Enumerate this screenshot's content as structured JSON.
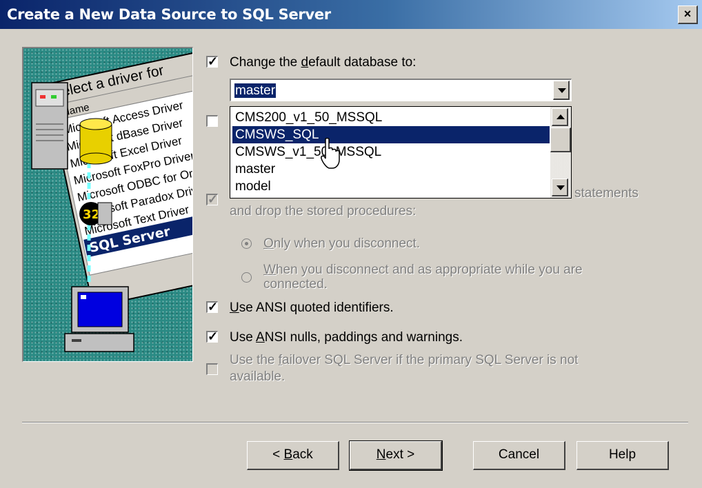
{
  "window": {
    "title": "Create a New Data Source to SQL Server",
    "close_glyph": "×"
  },
  "illustration": {
    "heading": "Select a driver for",
    "column_header": "Name",
    "drivers": [
      "Microsoft Access Driver",
      "Microsoft dBase Driver",
      "Microsoft Excel Driver",
      "Microsoft FoxPro Driver",
      "Microsoft ODBC for Oracle",
      "Microsoft Paradox Driver",
      "Microsoft Text Driver",
      "SQL Server"
    ],
    "badge": "32"
  },
  "options": {
    "change_db": {
      "pre": "Change the ",
      "u": "d",
      "post": "efault database to:",
      "checked": true
    },
    "database_combo": {
      "value": "master"
    },
    "attach_db": {
      "checked": false
    },
    "create_temp": {
      "visible_text": "statements",
      "line2": "and drop the stored procedures:",
      "checked": true,
      "enabled": false
    },
    "radio_only": {
      "u": "O",
      "post": "nly when you disconnect.",
      "selected": true
    },
    "radio_when": {
      "u": "W",
      "post": "hen you disconnect and as appropriate while you are",
      "line2": "connected.",
      "selected": false
    },
    "ansi_quoted": {
      "u": "U",
      "post": "se ANSI quoted identifiers.",
      "checked": true
    },
    "ansi_nulls": {
      "pre": "Use ",
      "u": "A",
      "post": "NSI nulls, paddings and warnings.",
      "checked": true
    },
    "failover": {
      "pre": "Use the ",
      "u": "f",
      "post": "ailover SQL Server if the primary SQL Server is not",
      "line2": "available.",
      "checked": false
    }
  },
  "dropdown": {
    "items": [
      "CMS200_v1_50_MSSQL",
      "CMSWS_SQL",
      "CMSWS_v1_50_MSSQL",
      "master",
      "model"
    ],
    "selected_index": 1
  },
  "buttons": {
    "back": {
      "pre": "< ",
      "u": "B",
      "post": "ack"
    },
    "next": {
      "u": "N",
      "post": "ext >"
    },
    "cancel": "Cancel",
    "help": "Help"
  },
  "colors": {
    "titlebar": "#0a246a",
    "selection": "#0a246a",
    "face": "#d4d0c8",
    "art_teal": "#2a8a84"
  }
}
